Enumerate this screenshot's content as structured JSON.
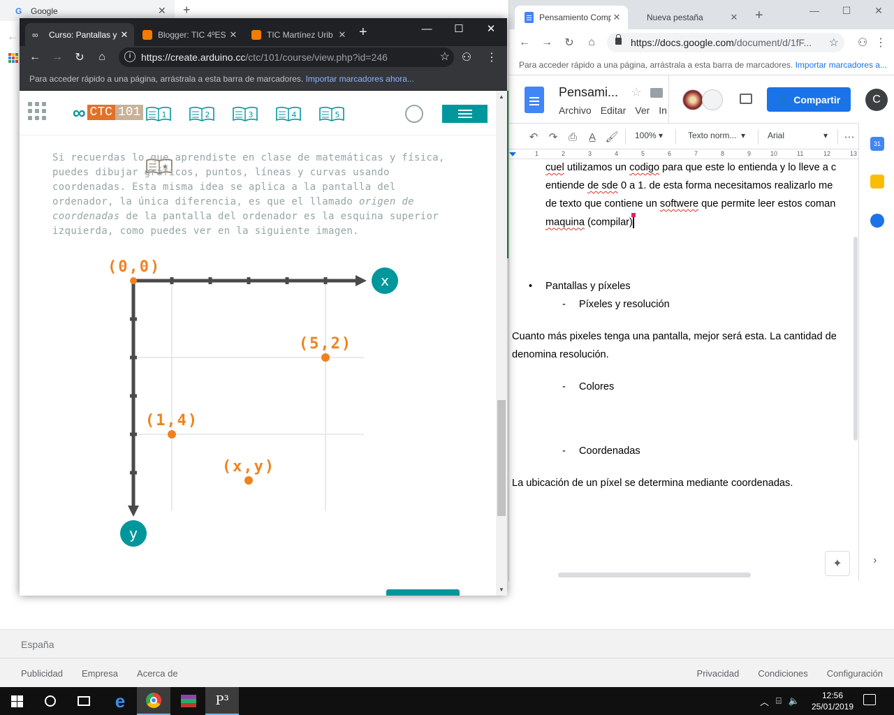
{
  "background": {
    "tab_title": "Google",
    "tab_letter": "G",
    "footer_country": "España",
    "footer_left": [
      "Publicidad",
      "Empresa",
      "Acerca de"
    ],
    "footer_right": [
      "Privacidad",
      "Condiciones",
      "Configuración"
    ]
  },
  "left_window": {
    "tabs": [
      {
        "title": "Curso: Pantallas y",
        "favicon_color": "#5f6368"
      },
      {
        "title": "Blogger: TIC 4ºES",
        "favicon_color": "#f57c00"
      },
      {
        "title": "TIC Martínez Urib",
        "favicon_color": "#f57c00"
      }
    ],
    "url_host": "https://create.arduino.cc",
    "url_path": "/ctc/101/course/view.php?id=246",
    "bookmarks_hint": "Para acceder rápido a una página, arrástrala a esta barra de marcadores.",
    "bookmarks_link": "Importar marcadores ahora...",
    "logo_ctc": "CTC",
    "logo_101": "101",
    "books": [
      "1",
      "2",
      "3",
      "4",
      "5"
    ],
    "paragraph_1": "Si recuerdas lo que aprendiste en clase de matemáticas y física, puedes dibujar gráficos, puntos, líneas y curvas usando coordenadas. Esta misma idea se aplica a la pantalla del ordenador, la única diferencia, es que el llamado ",
    "paragraph_em": "origen de coordenadas",
    "paragraph_2": " de la pantalla del ordenador es la esquina superior izquierda, como puedes ver en la siguiente imagen.",
    "diagram": {
      "origin_label": "(0,0)",
      "x_label": "x",
      "y_label": "y",
      "points": [
        {
          "label": "(5,2)",
          "x": 5,
          "y": 2
        },
        {
          "label": "(1,4)",
          "x": 1,
          "y": 4
        },
        {
          "label": "(x,y)",
          "x": 3,
          "y": 5.2
        }
      ],
      "accent": "#f0821e",
      "teal": "#00979c",
      "axis_color": "#4a4a4a"
    }
  },
  "right_window": {
    "tabs": [
      {
        "title": "Pensamiento Comp"
      },
      {
        "title": "Nueva pestaña"
      }
    ],
    "url_host": "https://docs.google.com",
    "url_path": "/document/d/1fF...",
    "bookmarks_hint": "Para acceder rápido a una página, arrástrala a esta barra de marcadores.",
    "bookmarks_link": "Importar marcadores a...",
    "doc_title": "Pensami...",
    "menus": [
      "Archivo",
      "Editar",
      "Ver",
      "In"
    ],
    "share_label": "Compartir",
    "user_initial": "C",
    "zoom": "100%",
    "style": "Texto norm...",
    "font": "Arial",
    "ruler_numbers": [
      "1",
      "2",
      "3",
      "4",
      "5",
      "6",
      "7",
      "8",
      "9",
      "10",
      "11",
      "12",
      "13"
    ],
    "doc": {
      "line1_a": "cuel",
      "line1_b": " utilizamos un ",
      "line1_c": "codigo",
      "line1_d": " para que este lo entienda y lo lleve a c",
      "line2_a": "entiende ",
      "line2_b": "de sde",
      "line2_c": " 0 a 1. de esta forma necesitamos realizarlo  me",
      "line3_a": "de texto que contiene un ",
      "line3_b": "softwere",
      "line3_c": " que permite leer estos coman",
      "line4_a": "maquina",
      "line4_b": " (compilar)",
      "bullet_1": "Pantallas y píxeles",
      "sub_1": "Píxeles y resolución",
      "para_1a": "Cuanto más pixeles tenga una pantalla, mejor será esta. La cantidad de",
      "para_1b": "denomina resolución.",
      "sub_2": "Colores",
      "sub_3": "Coordenadas",
      "para_2": "La ubicación de un píxel se determina mediante coordenadas.",
      "bullet_mark": "•",
      "dash_mark": "-"
    }
  },
  "taskbar": {
    "time": "12:56",
    "date": "25/01/2019"
  }
}
